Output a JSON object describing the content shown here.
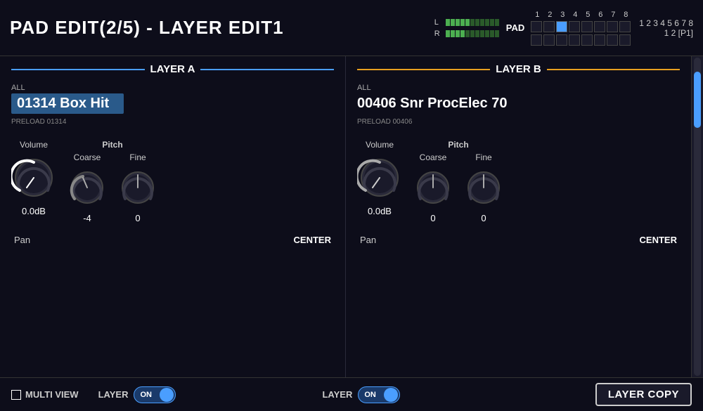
{
  "header": {
    "title": "PAD EDIT(2/5) - LAYER EDIT1",
    "pad_label": "PAD",
    "level_L": "L",
    "level_R": "R",
    "pad_numbers": [
      "1",
      "2",
      "3",
      "4",
      "5",
      "6",
      "7",
      "8"
    ],
    "pad_bank": "1  2  [P1]"
  },
  "layer_a": {
    "title": "LAYER A",
    "all_label": "ALL",
    "sample_name": "01314 Box Hit",
    "preload": "PRELOAD  01314",
    "volume_label": "Volume",
    "volume_value": "0.0dB",
    "pitch_label": "Pitch",
    "coarse_label": "Coarse",
    "coarse_value": "-4",
    "fine_label": "Fine",
    "fine_value": "0",
    "pan_label": "Pan",
    "pan_value": "CENTER",
    "layer_label": "LAYER",
    "layer_state": "ON"
  },
  "layer_b": {
    "title": "LAYER B",
    "all_label": "ALL",
    "sample_name": "00406 Snr ProcElec 70",
    "preload": "PRELOAD  00406",
    "volume_label": "Volume",
    "volume_value": "0.0dB",
    "pitch_label": "Pitch",
    "coarse_label": "Coarse",
    "coarse_value": "0",
    "fine_label": "Fine",
    "fine_value": "0",
    "pan_label": "Pan",
    "pan_value": "CENTER",
    "layer_label": "LAYER",
    "layer_state": "ON"
  },
  "footer": {
    "multi_view_label": "MULTI VIEW",
    "layer_copy_label": "LAYER COPY"
  },
  "colors": {
    "layer_a_accent": "#4a9eff",
    "layer_b_accent": "#e8a020",
    "bg": "#0d0d1a",
    "knob_track": "#3a3a4a",
    "knob_active_a": "#ffffff",
    "knob_active_b": "#888888"
  }
}
